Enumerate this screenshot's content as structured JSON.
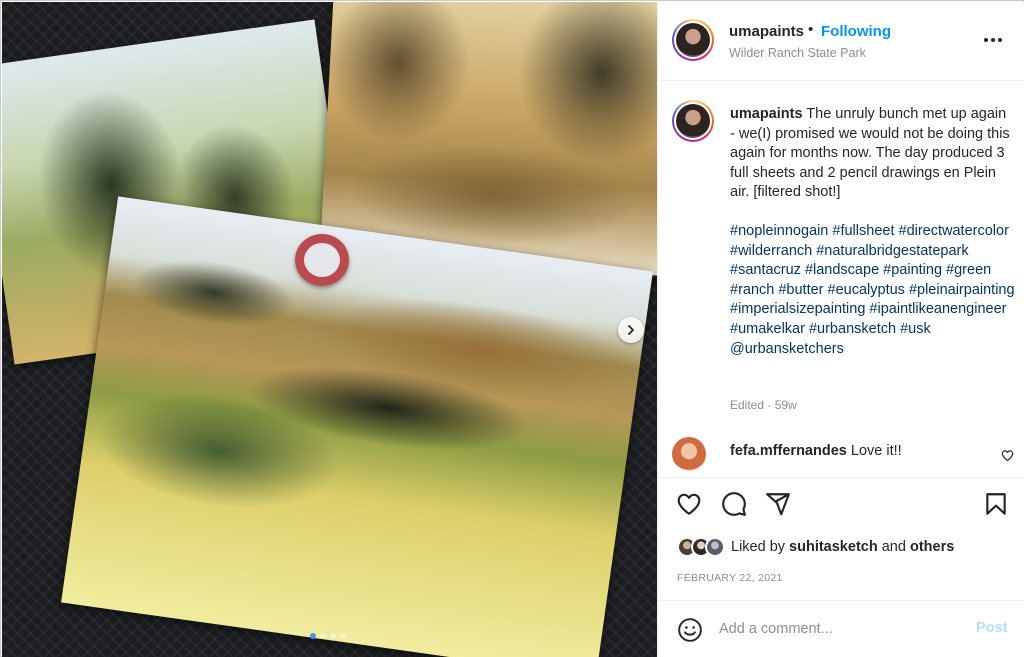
{
  "post": {
    "username": "umapaints",
    "separator": "•",
    "follow_label": "Following",
    "location": "Wilder Ranch State Park",
    "caption_text": "The unruly bunch met up again - we(I) promised we would not be doing this again for months now. The day produced 3 full sheets and 2 pencil drawings en Plein air. [filtered shot!]",
    "hashtags": "#nopleinnogain #fullsheet #directwatercolor #wilderranch #naturalbridgestatepark #santacruz #landscape #painting #green #ranch #butter #eucalyptus #pleinairpainting #imperialsizepainting #ipaintlikeanengineer #umakelkar #urbansketch #usk @urbansketchers",
    "meta": "Edited · 59w"
  },
  "comment": {
    "username": "fefa.mffernandes",
    "text": "Love it!!"
  },
  "likes": {
    "prefix": "Liked by",
    "user": "suhitasketch",
    "conjunction": "and",
    "others": "others"
  },
  "date": "FEBRUARY 22, 2021",
  "add_comment": {
    "placeholder": "Add a comment...",
    "post_label": "Post"
  },
  "carousel": {
    "slide_count": 4,
    "active_index": 0
  },
  "colors": {
    "link": "#0095f6",
    "hashtag": "#00376b",
    "muted": "#8e8e8e",
    "post_disabled": "#b2dffc"
  },
  "icons": [
    "next-chevron-icon",
    "more-options-icon",
    "heart-icon",
    "comment-icon",
    "share-icon",
    "bookmark-icon",
    "emoji-icon"
  ]
}
